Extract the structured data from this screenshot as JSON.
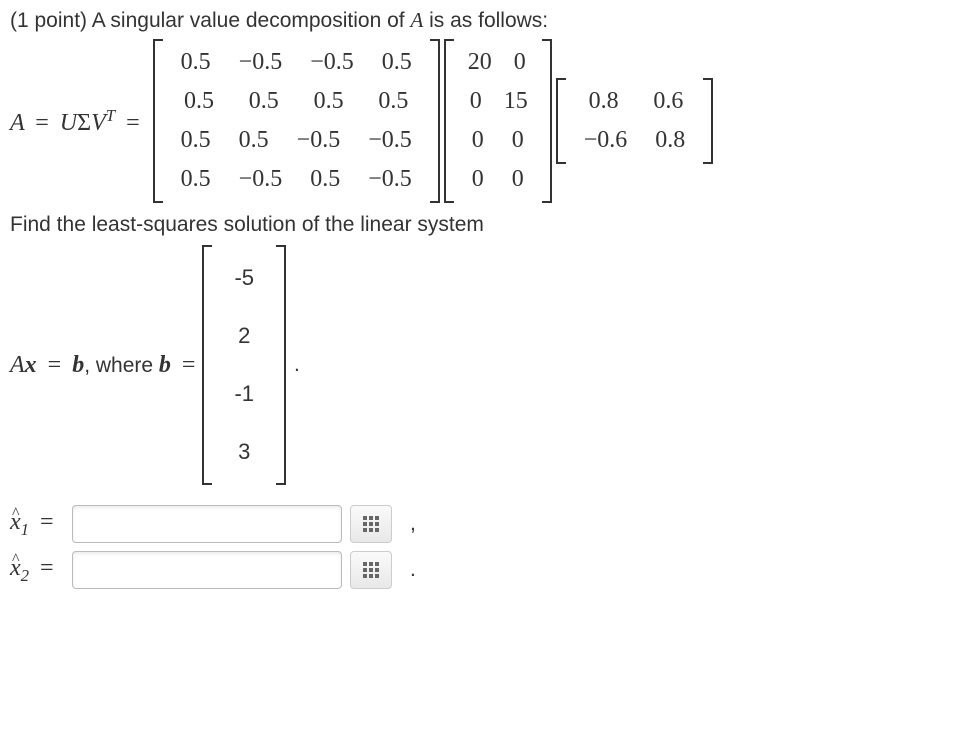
{
  "points_label": "(1 point)",
  "intro_text": "A singular value decomposition of ",
  "intro_var": "A",
  "intro_tail": " is as follows:",
  "svd_lhs": {
    "A": "A",
    "eq1": "=",
    "U": "U",
    "Sigma": "Σ",
    "V": "V",
    "T": "T",
    "eq2": "="
  },
  "U_matrix": [
    [
      "0.5",
      "−0.5",
      "−0.5",
      "0.5"
    ],
    [
      "0.5",
      "0.5",
      "0.5",
      "0.5"
    ],
    [
      "0.5",
      "0.5",
      "−0.5",
      "−0.5"
    ],
    [
      "0.5",
      "−0.5",
      "0.5",
      "−0.5"
    ]
  ],
  "Sigma_matrix": [
    [
      "20",
      "0"
    ],
    [
      "0",
      "15"
    ],
    [
      "0",
      "0"
    ],
    [
      "0",
      "0"
    ]
  ],
  "VT_matrix": [
    [
      "0.8",
      "0.6"
    ],
    [
      "−0.6",
      "0.8"
    ]
  ],
  "find_text": "Find the least-squares solution of the linear system",
  "axb": {
    "A": "A",
    "x": "x",
    "eq": "=",
    "b": "b",
    "comma": ", ",
    "where": "where ",
    "b2": "b",
    "eq2": "="
  },
  "b_vector": [
    "-5",
    "2",
    "-1",
    "3"
  ],
  "b_tail": ".",
  "answers": [
    {
      "label_x": "x",
      "label_sub": "1",
      "eq": "=",
      "punct": ","
    },
    {
      "label_x": "x",
      "label_sub": "2",
      "eq": "=",
      "punct": "."
    }
  ]
}
